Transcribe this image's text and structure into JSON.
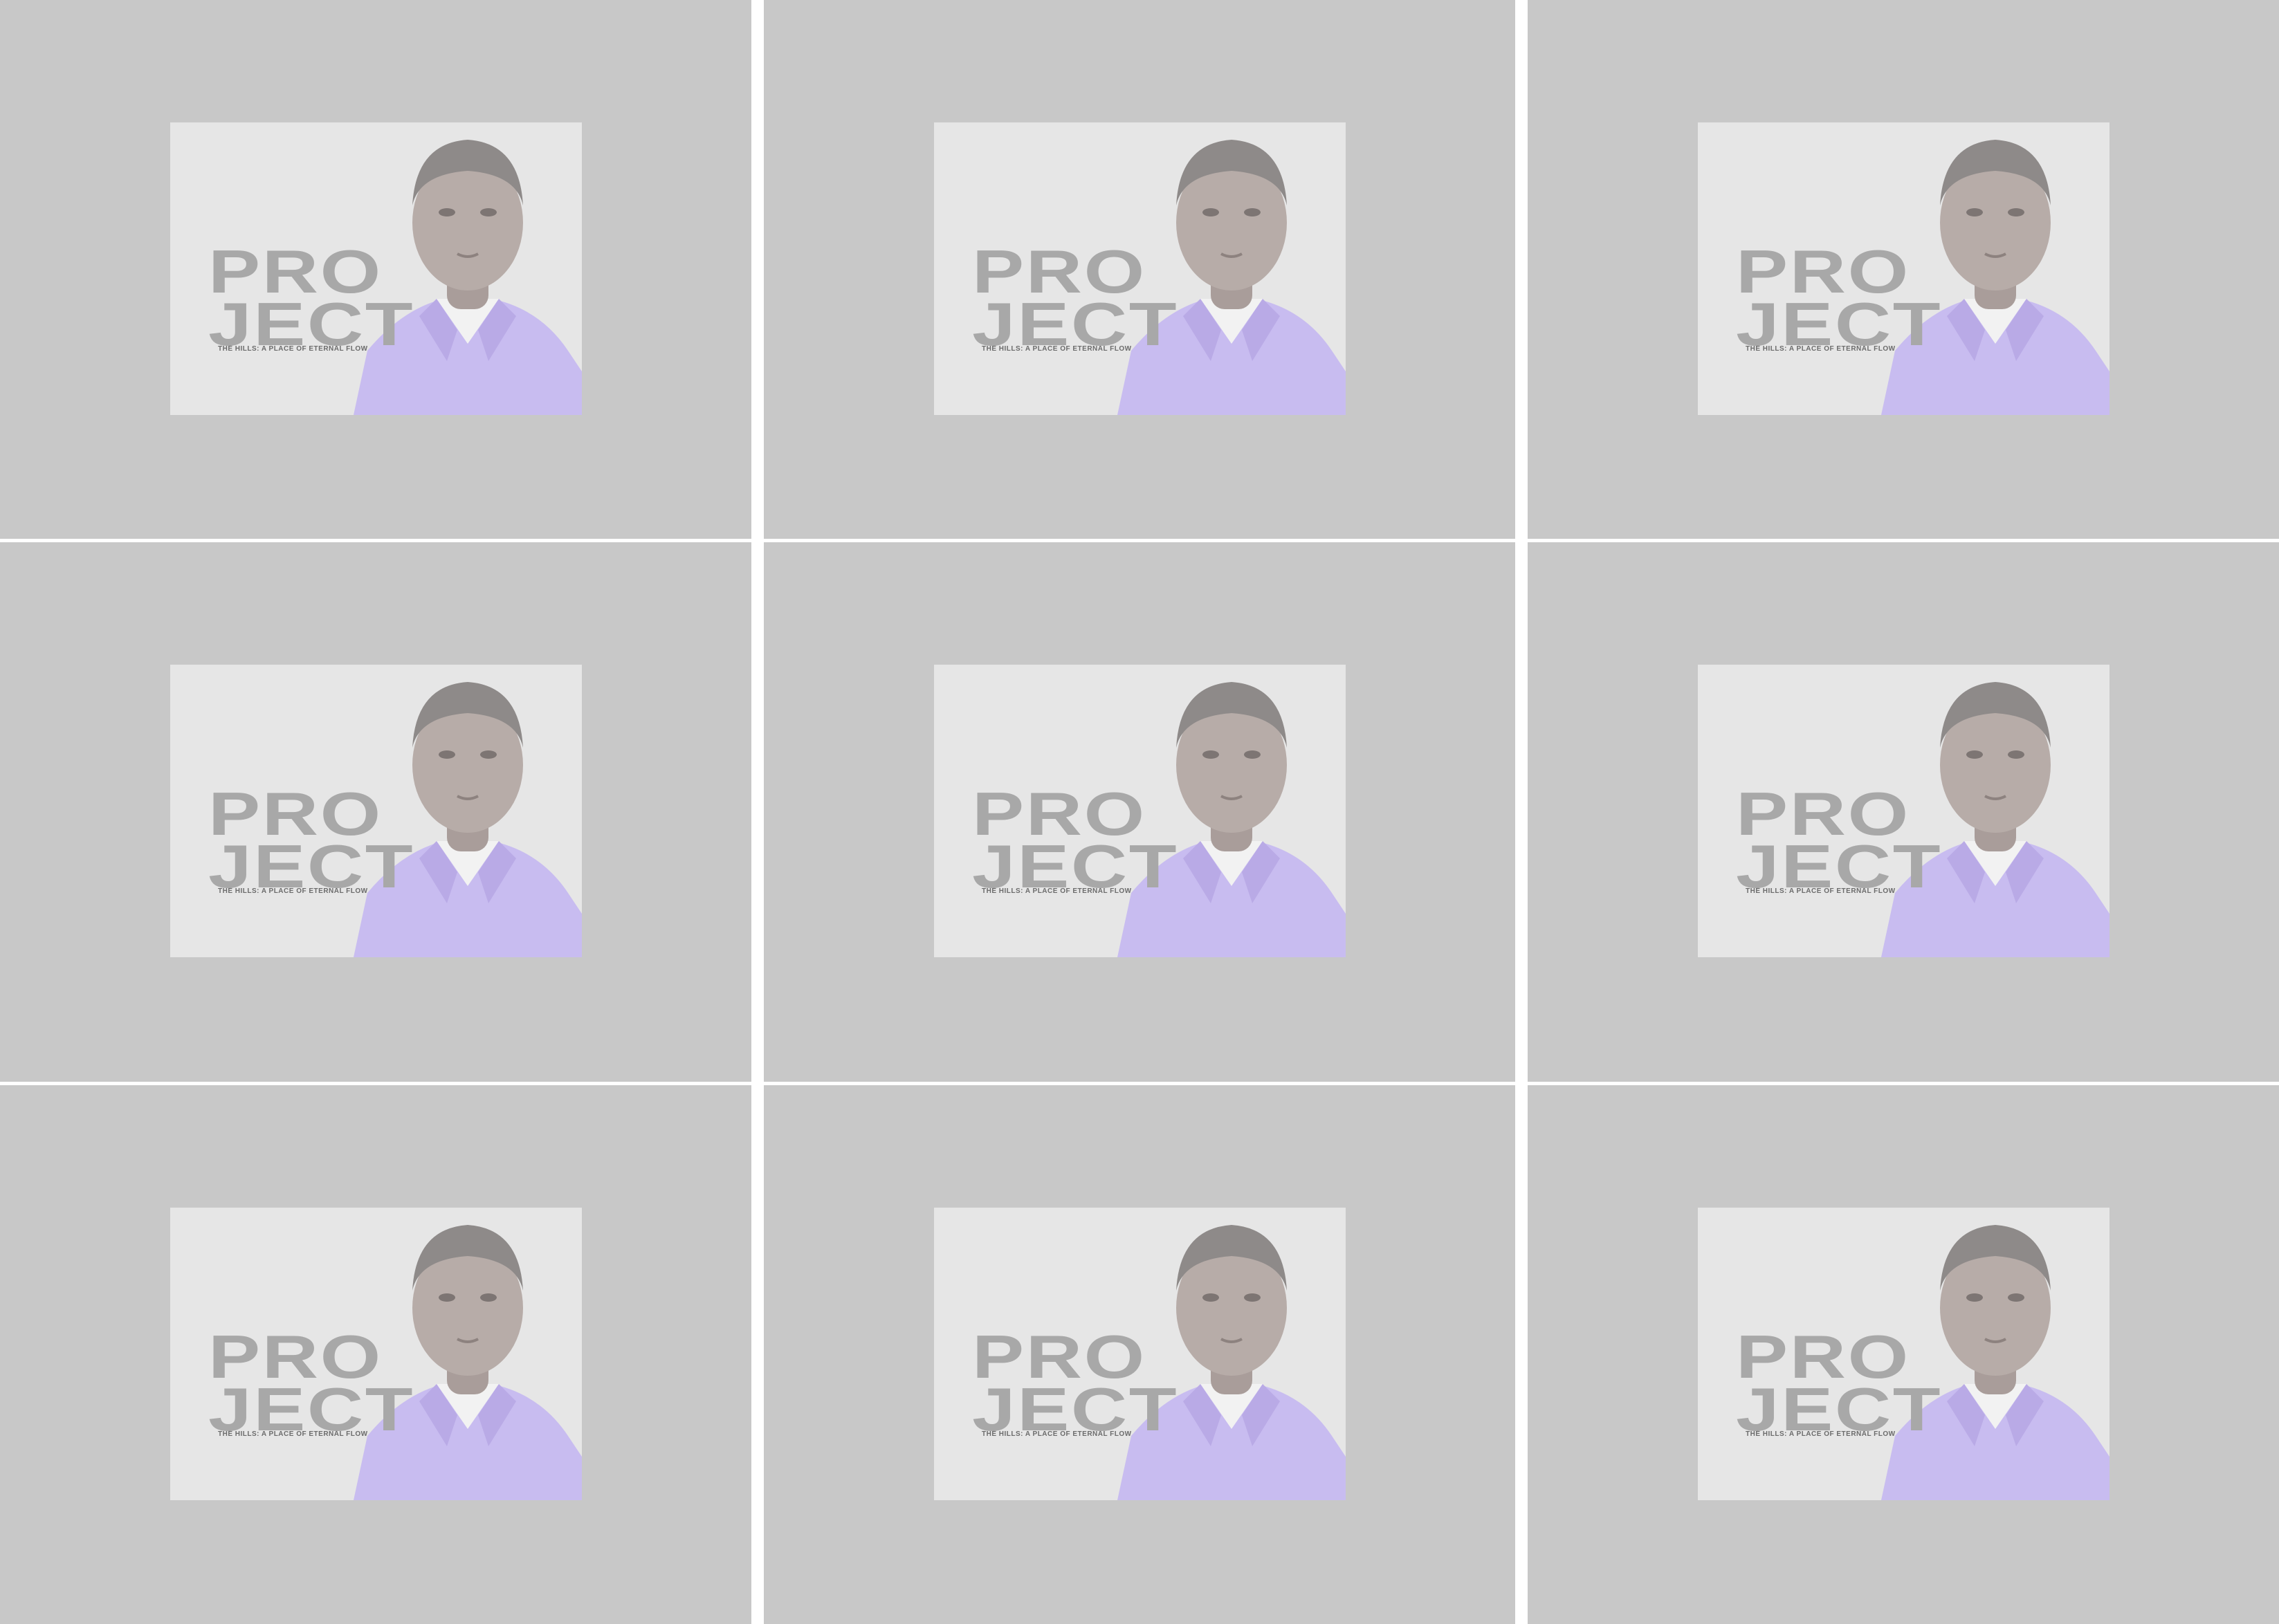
{
  "card": {
    "title_line1": "PRO",
    "title_line2": "JECT",
    "subtitle": "THE HILLS: A PLACE OF ETERNAL FLOW"
  },
  "colors": {
    "background_white": "#ffffff",
    "panel_gray": "#c8c8c8",
    "card_light": "#e6e6e6",
    "title_gray": "#a8a8a8",
    "shirt_lavender": "#c8bcf0",
    "skin_muted": "#b7aca8"
  },
  "panels": [
    {
      "id": "r1c1"
    },
    {
      "id": "r1c2"
    },
    {
      "id": "r1c3"
    },
    {
      "id": "r2c1"
    },
    {
      "id": "r2c2"
    },
    {
      "id": "r2c3"
    },
    {
      "id": "r3c1"
    },
    {
      "id": "r3c2"
    },
    {
      "id": "r3c3"
    }
  ]
}
